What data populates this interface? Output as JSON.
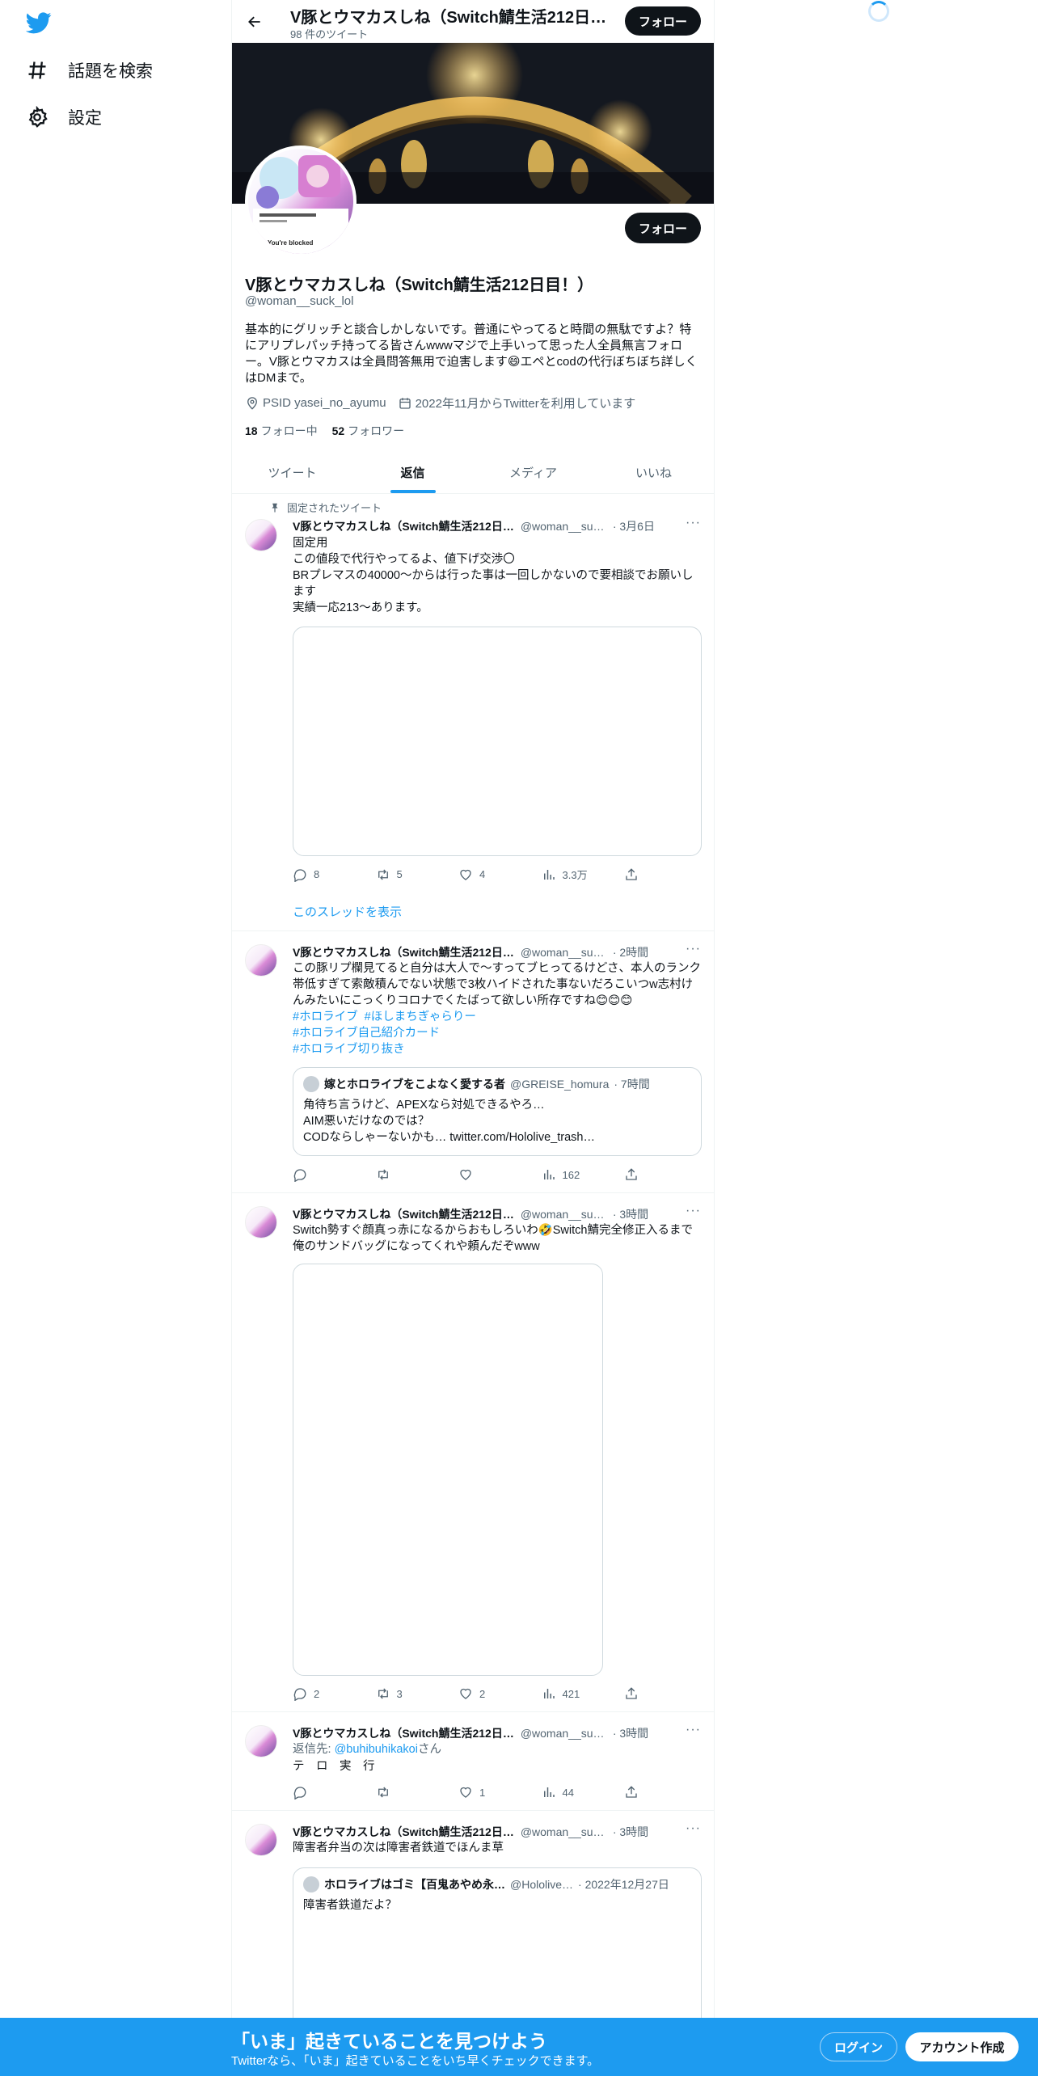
{
  "nav": {
    "explore_label": "話題を検索",
    "settings_label": "設定"
  },
  "header": {
    "name": "V豚とウマカスしね（Switch鯖生活212日目…",
    "tweet_count": "98 件のツイート",
    "follow_label": "フォロー"
  },
  "profile": {
    "name": "V豚とウマカスしね（Switch鯖生活212日目！）",
    "handle": "@woman__suck_lol",
    "follow_label": "フォロー",
    "avatar_text": "You're blocked",
    "bio": "基本的にグリッチと談合しかしないです。普通にやってると時間の無駄ですよ？特にアリプレパッチ持ってる皆さんwwwマジで上手いって思った人全員無言フォロー。V豚とウマカスは全員問答無用で迫害します😄エペとcodの代行ぼちぼち詳しくはDMまで。",
    "location": "PSID yasei_no_ayumu",
    "joined": "2022年11月からTwitterを利用しています",
    "following_count": "18",
    "following_label": "フォロー中",
    "followers_count": "52",
    "followers_label": "フォロワー"
  },
  "tabs": [
    {
      "label": "ツイート"
    },
    {
      "label": "返信"
    },
    {
      "label": "メディア"
    },
    {
      "label": "いいね"
    }
  ],
  "pinned_label": "固定されたツイート",
  "show_thread_label": "このスレッドを表示",
  "tweets": [
    {
      "name": "V豚とウマカスしね（Switch鯖生活212日…",
      "handle": "@woman__suc…",
      "time": "· 3月6日",
      "text": "固定用\nこの値段で代行やってるよ、値下げ交渉〇\nBRプレマスの40000〜からは行った事は一回しかないので要相談でお願いします\n実績一応213〜あります。",
      "replies": "8",
      "retweets": "5",
      "likes": "4",
      "views": "3.3万"
    },
    {
      "name": "V豚とウマカスしね（Switch鯖生活212日…",
      "handle": "@woman__suc…",
      "time": "· 2時間",
      "text": "この豚リプ欄見てると自分は大人で〜すってブヒってるけどさ、本人のランク帯低すぎて索敵積んでない状態で3枚ハイドされた事ないだろこいつw志村けんみたいにこっくりコロナでくたばって欲しい所存ですね😊😊😊",
      "hashtags": [
        "#ホロライブ",
        "#ほしまちぎゃらりー",
        "#ホロライブ自己紹介カード",
        "#ホロライブ切り抜き"
      ],
      "quote_name": "嫁とホロライブをこよなく愛する者",
      "quote_handle": "@GREISE_homura",
      "quote_time": "· 7時間",
      "quote_text": "角待ち言うけど、APEXなら対処できるやろ…\nAIM悪いだけなのでは？\nCODならしゃーないかも… twitter.com/Hololive_trash…",
      "replies": "",
      "retweets": "",
      "likes": "",
      "views": "162"
    },
    {
      "name": "V豚とウマカスしね（Switch鯖生活212日…",
      "handle": "@woman__suc…",
      "time": "· 3時間",
      "text": "Switch勢すぐ顔真っ赤になるからおもしろいわ🤣Switch鯖完全修正入るまで俺のサンドバッグになってくれや頼んだぞwww",
      "replies": "2",
      "retweets": "3",
      "likes": "2",
      "views": "421"
    },
    {
      "name": "V豚とウマカスしね（Switch鯖生活212日…",
      "handle": "@woman__suc…",
      "time": "· 3時間",
      "reply_prefix": "返信先: ",
      "reply_to": "@buhibuhikakoi",
      "reply_suffix": "さん",
      "text": "テ　ロ　実　行",
      "replies": "",
      "retweets": "",
      "likes": "1",
      "views": "44"
    },
    {
      "name": "V豚とウマカスしね（Switch鯖生活212日…",
      "handle": "@woman__suc…",
      "time": "· 3時間",
      "text": "障害者弁当の次は障害者鉄道でほんま草",
      "quote_name": "ホロライブはゴミ【百鬼あやめ永…",
      "quote_handle": "@Hololive…",
      "quote_time": "· 2022年12月27日",
      "quote_text": "障害者鉄道だよ？"
    }
  ],
  "bottom": {
    "title": "「いま」起きていることを見つけよう",
    "subtitle": "Twitterなら、「いま」起きていることをいち早くチェックできます。",
    "login_label": "ログイン",
    "signup_label": "アカウント作成"
  },
  "colors": {
    "accent": "#1d9bf0",
    "text": "#0f1419",
    "muted": "#536471"
  }
}
